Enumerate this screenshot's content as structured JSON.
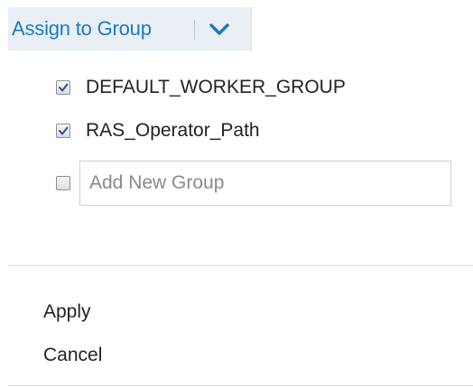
{
  "split_button": {
    "label": "Assign to Group",
    "caret_icon": "chevron-down-icon",
    "accent_color": "#1c7bbf",
    "background_color": "#e9eff4"
  },
  "groups": [
    {
      "label": "DEFAULT_WORKER_GROUP",
      "checked": true
    },
    {
      "label": "RAS_Operator_Path",
      "checked": true
    }
  ],
  "new_group": {
    "checked": false,
    "placeholder": "Add New Group",
    "value": ""
  },
  "actions": {
    "apply_label": "Apply",
    "cancel_label": "Cancel"
  }
}
